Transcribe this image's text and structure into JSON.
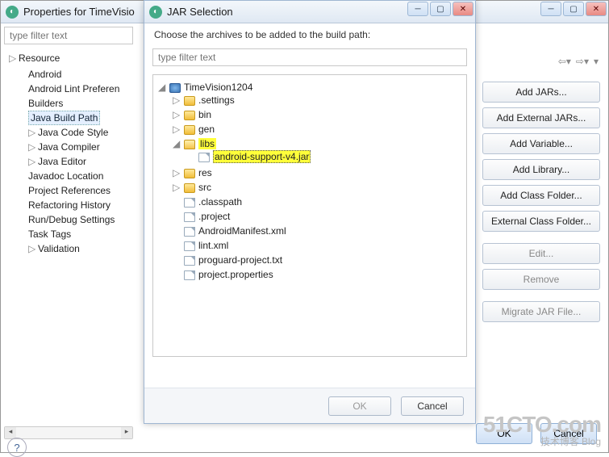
{
  "props_window": {
    "title": "Properties for TimeVisio",
    "filter_placeholder": "type filter text",
    "tree": {
      "resource": "Resource",
      "android": "Android",
      "lint": "Android Lint Preferen",
      "builders": "Builders",
      "buildpath": "Java Build Path",
      "codestyle": "Java Code Style",
      "compiler": "Java Compiler",
      "editor": "Java Editor",
      "javadoc": "Javadoc Location",
      "projectrefs": "Project References",
      "refactor": "Refactoring History",
      "rundebug": "Run/Debug Settings",
      "tasktags": "Task Tags",
      "validation": "Validation"
    },
    "buttons": {
      "addjars": "Add JARs...",
      "addext": "Add External JARs...",
      "addvar": "Add Variable...",
      "addlib": "Add Library...",
      "addclass": "Add Class Folder...",
      "addextclass": "External Class Folder...",
      "edit": "Edit...",
      "remove": "Remove",
      "migrate": "Migrate JAR File..."
    },
    "footer": {
      "ok": "OK",
      "cancel": "Cancel"
    }
  },
  "dialog": {
    "title": "JAR Selection",
    "instruction": "Choose the archives to be added to the build path:",
    "filter_placeholder": "type filter text",
    "project": "TimeVision1204",
    "folders": {
      "settings": ".settings",
      "bin": "bin",
      "gen": "gen",
      "libs": "libs",
      "res": "res",
      "src": "src"
    },
    "files": {
      "supportjar": "android-support-v4.jar",
      "classpath": ".classpath",
      "project": ".project",
      "manifest": "AndroidManifest.xml",
      "lint": "lint.xml",
      "proguard": "proguard-project.txt",
      "props": "project.properties"
    },
    "ok": "OK",
    "cancel": "Cancel"
  },
  "watermark": {
    "main": "51CTO.com",
    "sub": "技术博客",
    "sub2": "Blog"
  }
}
